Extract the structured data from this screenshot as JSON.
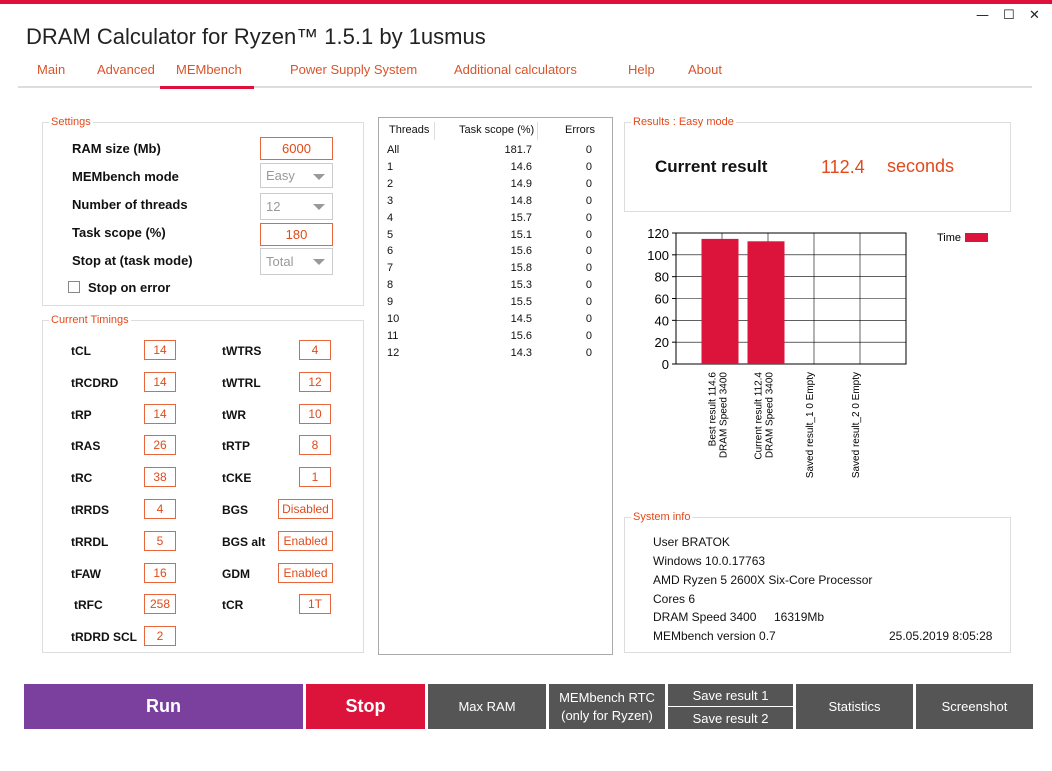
{
  "window": {
    "title": "DRAM Calculator for Ryzen™ 1.5.1 by 1usmus",
    "minimize": "—",
    "maximize": "☐",
    "close": "✕"
  },
  "nav": {
    "tabs": [
      "Main",
      "Advanced",
      "MEMbench",
      "Power Supply System",
      "Additional calculators",
      "Help",
      "About"
    ],
    "active": "MEMbench"
  },
  "settings": {
    "group_label": "Settings",
    "ram_size_label": "RAM size (Mb)",
    "ram_size_value": "6000",
    "mode_label": "MEMbench mode",
    "mode_value": "Easy",
    "threads_label": "Number of threads",
    "threads_value": "12",
    "task_scope_label": "Task scope (%)",
    "task_scope_value": "180",
    "stop_at_label": "Stop at (task mode)",
    "stop_at_value": "Total",
    "stop_on_error_label": "Stop on error"
  },
  "timings": {
    "group_label": "Current Timings",
    "left": [
      {
        "label": "tCL",
        "value": "14"
      },
      {
        "label": "tRCDRD",
        "value": "14"
      },
      {
        "label": "tRP",
        "value": "14"
      },
      {
        "label": "tRAS",
        "value": "26"
      },
      {
        "label": "tRC",
        "value": "38"
      },
      {
        "label": "tRRDS",
        "value": "4"
      },
      {
        "label": "tRRDL",
        "value": "5"
      },
      {
        "label": "tFAW",
        "value": "16"
      },
      {
        "label": "tRFC",
        "value": "258"
      },
      {
        "label": "tRDRD SCL",
        "value": "2"
      }
    ],
    "right": [
      {
        "label": "tWTRS",
        "value": "4"
      },
      {
        "label": "tWTRL",
        "value": "12"
      },
      {
        "label": "tWR",
        "value": "10"
      },
      {
        "label": "tRTP",
        "value": "8"
      },
      {
        "label": "tCKE",
        "value": "1"
      },
      {
        "label": "BGS",
        "value": "Disabled"
      },
      {
        "label": "BGS alt",
        "value": "Enabled"
      },
      {
        "label": "GDM",
        "value": "Enabled"
      },
      {
        "label": "tCR",
        "value": "1T"
      }
    ]
  },
  "threads_table": {
    "headers": [
      "Threads",
      "Task scope (%)",
      "Errors"
    ],
    "rows": [
      [
        "All",
        "181.7",
        "0"
      ],
      [
        "1",
        "14.6",
        "0"
      ],
      [
        "2",
        "14.9",
        "0"
      ],
      [
        "3",
        "14.8",
        "0"
      ],
      [
        "4",
        "15.7",
        "0"
      ],
      [
        "5",
        "15.1",
        "0"
      ],
      [
        "6",
        "15.6",
        "0"
      ],
      [
        "7",
        "15.8",
        "0"
      ],
      [
        "8",
        "15.3",
        "0"
      ],
      [
        "9",
        "15.5",
        "0"
      ],
      [
        "10",
        "14.5",
        "0"
      ],
      [
        "11",
        "15.6",
        "0"
      ],
      [
        "12",
        "14.3",
        "0"
      ]
    ]
  },
  "results": {
    "group_label": "Results : Easy mode",
    "current_label": "Current result",
    "current_value": "112.4",
    "unit": "seconds"
  },
  "chart_data": {
    "type": "bar",
    "categories": [
      "Best result 114.6 DRAM Speed 3400",
      "Current result 112.4 DRAM Speed 3400",
      "Saved result_1 0 Empty",
      "Saved result_2 0 Empty"
    ],
    "category_lines": [
      [
        "Best result 114.6",
        "DRAM Speed 3400"
      ],
      [
        "Current result 112.4",
        "DRAM Speed 3400"
      ],
      [
        "Saved result_1 0 Empty"
      ],
      [
        "Saved result_2 0 Empty"
      ]
    ],
    "series": [
      {
        "name": "Time",
        "values": [
          114.6,
          112.4,
          0,
          0
        ],
        "color": "#dc143c"
      }
    ],
    "ylim": [
      0,
      120
    ],
    "yticks": [
      "0",
      "20",
      "40",
      "60",
      "80",
      "100",
      "120"
    ],
    "grid": true,
    "legend": "top-right"
  },
  "system_info": {
    "group_label": "System info",
    "user": "User BRATOK",
    "os": "Windows 10.0.17763",
    "cpu": "AMD Ryzen 5 2600X Six-Core Processor",
    "cores": "Cores 6",
    "dram_speed": "DRAM Speed 3400",
    "memory": "16319Mb",
    "version": "MEMbench version 0.7",
    "timestamp": "25.05.2019 8:05:28"
  },
  "buttons": {
    "run": "Run",
    "stop": "Stop",
    "max_ram": "Max RAM",
    "rtc_line1": "MEMbench RTC",
    "rtc_line2": "(only for Ryzen)",
    "save1": "Save result 1",
    "save2": "Save result 2",
    "statistics": "Statistics",
    "screenshot": "Screenshot"
  },
  "colors": {
    "accent": "#e0103c",
    "orange": "#e04a1c",
    "run": "#7b3f9e",
    "stop": "#dc143c",
    "gray_button": "#555555"
  }
}
